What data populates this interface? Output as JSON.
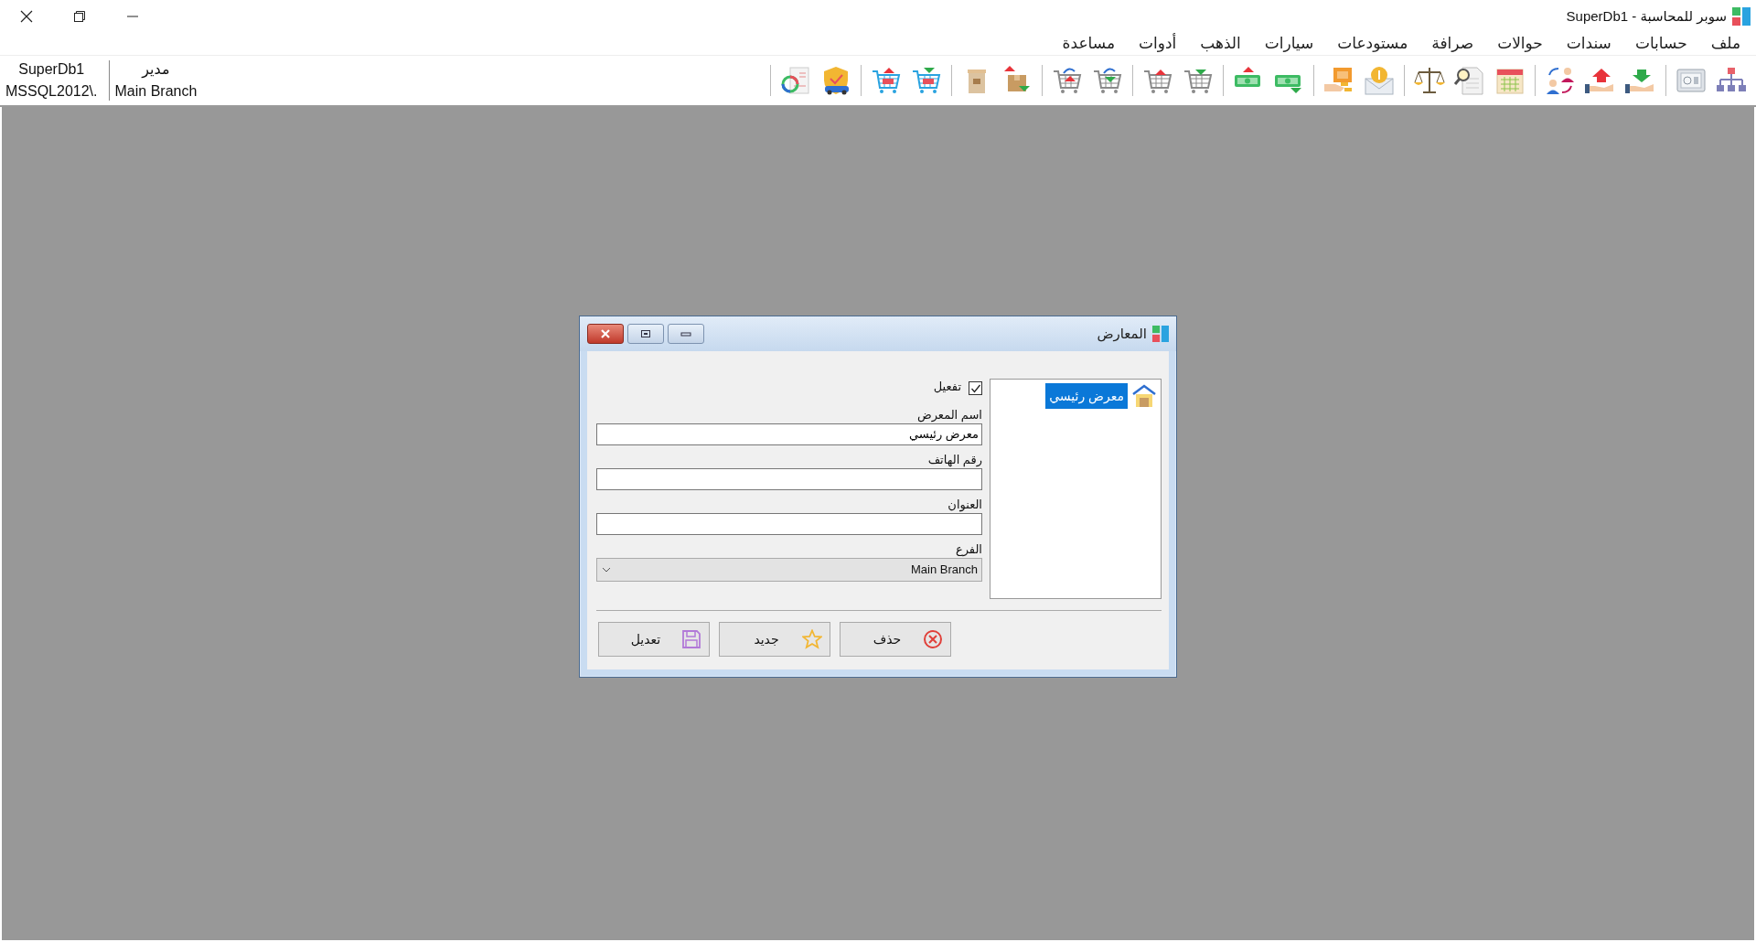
{
  "window": {
    "title": "سوبر للمحاسبة - SuperDb1"
  },
  "menu": [
    "ملف",
    "حسابات",
    "سندات",
    "حوالات",
    "صرافة",
    "مستودعات",
    "سيارات",
    "الذهب",
    "أدوات",
    "مساعدة"
  ],
  "session": {
    "database": "SuperDb1",
    "server": "MSSQL2012\\.",
    "user": "مدير",
    "branch": "Main Branch"
  },
  "dialog": {
    "title": "المعارض",
    "list": [
      {
        "label": "معرض رئيسي",
        "selected": true
      }
    ],
    "active": {
      "label": "تفعيل",
      "checked": true
    },
    "fields": [
      {
        "label": "اسم المعرض",
        "value": "معرض رئيسي"
      },
      {
        "label": "رقم الهاتف"
      },
      {
        "label": "العنوان"
      }
    ],
    "branch": {
      "label": "الفرع",
      "value": "Main Branch"
    },
    "buttons": [
      {
        "label": "حذف",
        "kind": "delete"
      },
      {
        "label": "جديد",
        "kind": "new"
      },
      {
        "label": "تعديل",
        "kind": "edit"
      }
    ]
  }
}
